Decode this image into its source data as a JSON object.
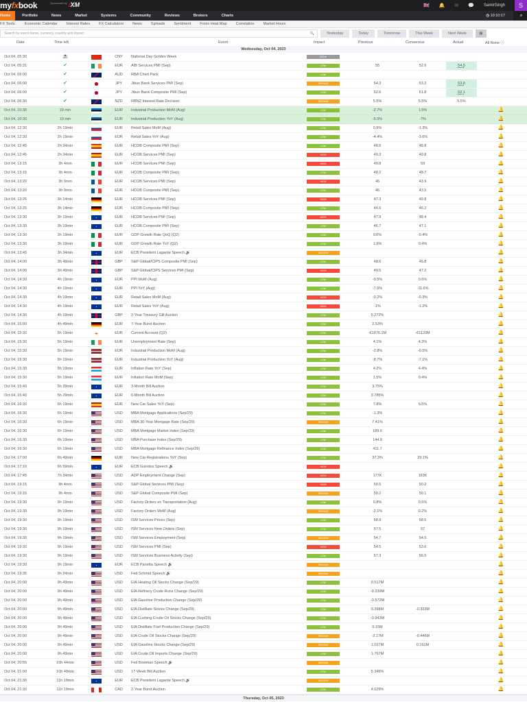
{
  "header": {
    "logo": "myfxbook",
    "sponsored": "Sponsored by",
    "sponsor": "XM",
    "user": "SamirSingh",
    "avatar": "S",
    "clock": "10:10:17"
  },
  "nav": [
    "Home",
    "Portfolio",
    "News",
    "Market",
    "Systems",
    "Community",
    "Reviews",
    "Brokers",
    "Charts"
  ],
  "tools": [
    "FX Tools:",
    "Economic Calendar",
    "Interest Rates",
    "FX Calculators",
    "News",
    "Spreads",
    "Sentiment",
    "Forex Heat Map",
    "Correlation",
    "Market Hours"
  ],
  "search": {
    "placeholder": "Search by event name, currency, country and impact"
  },
  "date_buttons": [
    "Yesterday",
    "Today",
    "Tomorrow",
    "This Week",
    "Next Week"
  ],
  "columns": {
    "date": "Date",
    "left": "Time left",
    "event": "Event",
    "impact": "Impact",
    "previous": "Previous",
    "consensus": "Consensus",
    "actual": "Actual",
    "allnone": "All None"
  },
  "day_header": "Wednesday, Oct 04, 2023",
  "next_day_header": "Thursday, Oct 05, 2023",
  "rows": [
    [
      "Oct 04, 05:30",
      "holiday",
      "cn",
      "CNY",
      "National Day Golden Week",
      "NONE",
      "",
      "",
      ""
    ],
    [
      "Oct 04, 05:31",
      "done",
      "ie",
      "EUR",
      "AIB Services PMI (Sep)",
      "LOW",
      "55",
      "52.9",
      "54.5"
    ],
    [
      "Oct 04, 06:00",
      "done",
      "au",
      "AUD",
      "RBA Chart Pack",
      "LOW",
      "",
      "",
      ""
    ],
    [
      "Oct 04, 06:00",
      "done",
      "jp",
      "JPY",
      "Jibun Bank Services PMI (Sep)",
      "MEDIUM",
      "54.3",
      "53.3",
      "53.8"
    ],
    [
      "Oct 04, 06:00",
      "done",
      "jp",
      "JPY",
      "Jibun Bank Composite PMI (Sep)",
      "LOW",
      "52.6",
      "51.8",
      "52.1"
    ],
    [
      "Oct 04, 06:30",
      "done",
      "nz",
      "NZD",
      "RBNZ Interest Rate Decision",
      "MEDIUM",
      "5.5%",
      "5.5%",
      "5.5%"
    ],
    [
      "Oct 04, 10:30",
      "19 min",
      "ee",
      "EUR",
      "Industrial Production MoM (Aug)",
      "LOW",
      "-2.7%",
      "1.5%",
      ""
    ],
    [
      "Oct 04, 10:30",
      "19 min",
      "ee",
      "EUR",
      "Industrial Production YoY (Aug)",
      "LOW",
      "-5.5%",
      "-7%",
      ""
    ],
    [
      "Oct 04, 12:30",
      "2h 19min",
      "sk",
      "EUR",
      "Retail Sales MoM (Aug)",
      "LOW",
      "0.9%",
      "-1.3%",
      ""
    ],
    [
      "Oct 04, 12:30",
      "2h 19min",
      "sk",
      "EUR",
      "Retail Sales YoY (Aug)",
      "LOW",
      "-4.4%",
      "-3.6%",
      ""
    ],
    [
      "Oct 04, 12:45",
      "2h 34min",
      "es",
      "EUR",
      "HCOB Composite PMI (Sep)",
      "LOW",
      "48.6",
      "48.8",
      ""
    ],
    [
      "Oct 04, 12:45",
      "2h 34min",
      "es",
      "EUR",
      "HCOB Services PMI (Sep)",
      "HIGH",
      "49.3",
      "49.8",
      ""
    ],
    [
      "Oct 04, 13:15",
      "3h 4min",
      "it",
      "EUR",
      "HCOB Services PMI (Sep)",
      "HIGH",
      "49.8",
      "50",
      ""
    ],
    [
      "Oct 04, 13:15",
      "3h 4min",
      "it",
      "EUR",
      "HCOB Composite PMI (Sep)",
      "LOW",
      "48.2",
      "48.7",
      ""
    ],
    [
      "Oct 04, 13:20",
      "3h 9min",
      "fr",
      "EUR",
      "HCOB Services PMI (Sep)",
      "HIGH",
      "46",
      "43.9",
      ""
    ],
    [
      "Oct 04, 13:20",
      "3h 9min",
      "fr",
      "EUR",
      "HCOB Composite PMI (Sep)",
      "LOW",
      "46",
      "43.5",
      ""
    ],
    [
      "Oct 04, 13:25",
      "3h 14min",
      "de",
      "EUR",
      "HCOB Services PMI (Sep)",
      "HIGH",
      "47.3",
      "49.8",
      ""
    ],
    [
      "Oct 04, 13:25",
      "3h 14min",
      "de",
      "EUR",
      "HCOB Composite PMI (Sep)",
      "LOW",
      "44.6",
      "46.2",
      ""
    ],
    [
      "Oct 04, 13:30",
      "3h 19min",
      "eu",
      "EUR",
      "HCOB Services PMI (Sep)",
      "HIGH",
      "47.9",
      "48.4",
      ""
    ],
    [
      "Oct 04, 13:30",
      "3h 19min",
      "eu",
      "EUR",
      "HCOB Composite PMI (Sep)",
      "LOW",
      "46.7",
      "47.1",
      ""
    ],
    [
      "Oct 04, 13:30",
      "3h 19min",
      "it",
      "EUR",
      "GDP Growth Rate QoQ (Q2)",
      "LOW",
      "0.6%",
      "-0.4%",
      ""
    ],
    [
      "Oct 04, 13:30",
      "3h 19min",
      "it",
      "EUR",
      "GDP Growth Rate YoY (Q2)",
      "LOW",
      "1.9%",
      "0.4%",
      ""
    ],
    [
      "Oct 04, 13:45",
      "3h 34min",
      "eu",
      "EUR",
      "ECB President Lagarde Speech 🔊",
      "MEDIUM",
      "",
      "",
      ""
    ],
    [
      "Oct 04, 14:00",
      "3h 49min",
      "gb",
      "GBP",
      "S&P Global/CIPS Composite PMI (Sep)",
      "LOW",
      "48.6",
      "46.8",
      ""
    ],
    [
      "Oct 04, 14:00",
      "3h 49min",
      "gb",
      "GBP",
      "S&P Global/CIPS Services PMI (Sep)",
      "HIGH",
      "49.5",
      "47.2",
      ""
    ],
    [
      "Oct 04, 14:30",
      "4h 19min",
      "eu",
      "EUR",
      "PPI MoM (Aug)",
      "LOW",
      "-0.5%",
      "0.6%",
      ""
    ],
    [
      "Oct 04, 14:30",
      "4h 19min",
      "eu",
      "EUR",
      "PPI YoY (Aug)",
      "LOW",
      "-7.6%",
      "-11.6%",
      ""
    ],
    [
      "Oct 04, 14:30",
      "4h 19min",
      "eu",
      "EUR",
      "Retail Sales MoM (Aug)",
      "HIGH",
      "-0.2%",
      "-0.3%",
      ""
    ],
    [
      "Oct 04, 14:30",
      "4h 19min",
      "eu",
      "EUR",
      "Retail Sales YoY (Aug)",
      "HIGH",
      "-1%",
      "-1.2%",
      ""
    ],
    [
      "Oct 04, 14:30",
      "4h 19min",
      "gb",
      "GBP",
      "2-Year Treasury Gilt Auction",
      "LOW",
      "5.272%",
      "",
      ""
    ],
    [
      "Oct 04, 15:00",
      "4h 49min",
      "de",
      "EUR",
      "7-Year Bund Auction",
      "LOW",
      "2.53%",
      "",
      ""
    ],
    [
      "Oct 04, 15:30",
      "5h 19min",
      "cy",
      "EUR",
      "Current Account (Q2)",
      "LOW",
      "-€1876.1M",
      "-€1120M",
      ""
    ],
    [
      "Oct 04, 15:30",
      "5h 19min",
      "ie",
      "EUR",
      "Unemployment Rate (Sep)",
      "LOW",
      "4.1%",
      "4.3%",
      ""
    ],
    [
      "Oct 04, 15:30",
      "5h 19min",
      "lv",
      "EUR",
      "Industrial Production MoM (Aug)",
      "LOW",
      "-2.8%",
      "-0.5%",
      ""
    ],
    [
      "Oct 04, 15:30",
      "5h 19min",
      "lv",
      "EUR",
      "Industrial Production YoY (Aug)",
      "LOW",
      "-8.7%",
      "-7.1%",
      ""
    ],
    [
      "Oct 04, 15:30",
      "5h 19min",
      "lu",
      "EUR",
      "Inflation Rate YoY (Sep)",
      "LOW",
      "4.2%",
      "4.4%",
      ""
    ],
    [
      "Oct 04, 15:30",
      "5h 19min",
      "lu",
      "EUR",
      "Inflation Rate MoM (Sep)",
      "LOW",
      "1.5%",
      "0.4%",
      ""
    ],
    [
      "Oct 04, 15:40",
      "5h 29min",
      "eu",
      "EUR",
      "3-Month Bill Auction",
      "LOW",
      "3.75%",
      "",
      ""
    ],
    [
      "Oct 04, 15:40",
      "5h 29min",
      "eu",
      "EUR",
      "6-Month Bill Auction",
      "LOW",
      "3.785%",
      "",
      ""
    ],
    [
      "Oct 04, 16:30",
      "6h 19min",
      "es",
      "EUR",
      "New Car Sales YoY (Sep)",
      "LOW",
      "7.8%",
      "6.5%",
      ""
    ],
    [
      "Oct 04, 16:30",
      "6h 19min",
      "us",
      "USD",
      "MBA Mortgage Applications (Sep/29)",
      "LOW",
      "-1.3%",
      "",
      ""
    ],
    [
      "Oct 04, 16:30",
      "6h 19min",
      "us",
      "USD",
      "MBA 30-Year Mortgage Rate (Sep/29)",
      "MEDIUM",
      "7.41%",
      "",
      ""
    ],
    [
      "Oct 04, 16:30",
      "6h 19min",
      "us",
      "USD",
      "MBA Mortgage Market Index (Sep/29)",
      "LOW",
      "189.6",
      "",
      ""
    ],
    [
      "Oct 04, 16:30",
      "6h 19min",
      "us",
      "USD",
      "MBA Purchase Index (Sep/29)",
      "LOW",
      "144.8",
      "",
      ""
    ],
    [
      "Oct 04, 16:30",
      "6h 19min",
      "us",
      "USD",
      "MBA Mortgage Refinance Index (Sep/29)",
      "LOW",
      "411.7",
      "",
      ""
    ],
    [
      "Oct 04, 17:00",
      "6h 49min",
      "de",
      "EUR",
      "New Car Registrations YoY (Sep)",
      "LOW",
      "37.3%",
      "29.1%",
      ""
    ],
    [
      "Oct 04, 17:10",
      "6h 59min",
      "eu",
      "EUR",
      "ECB Guindos Speech 🔊",
      "HIGH",
      "",
      "",
      ""
    ],
    [
      "Oct 04, 17:45",
      "7h 34min",
      "us",
      "USD",
      "ADP Employment Change (Sep)",
      "HIGH",
      "177K",
      "153K",
      ""
    ],
    [
      "Oct 04, 19:15",
      "9h 4min",
      "us",
      "USD",
      "S&P Global Services PMI (Sep)",
      "HIGH",
      "50.5",
      "50.2",
      ""
    ],
    [
      "Oct 04, 19:15",
      "9h 4min",
      "us",
      "USD",
      "S&P Global Composite PMI (Sep)",
      "MEDIUM",
      "50.2",
      "50.1",
      ""
    ],
    [
      "Oct 04, 19:30",
      "9h 19min",
      "us",
      "USD",
      "Factory Orders ex Transportation (Aug)",
      "LOW",
      "0.8%",
      "0.6%",
      ""
    ],
    [
      "Oct 04, 19:30",
      "9h 19min",
      "us",
      "USD",
      "Factory Orders MoM (Aug)",
      "MEDIUM",
      "-2.1%",
      "0.2%",
      ""
    ],
    [
      "Oct 04, 19:30",
      "9h 19min",
      "us",
      "USD",
      "ISM Services Prices (Sep)",
      "LOW",
      "58.9",
      "58.5",
      ""
    ],
    [
      "Oct 04, 19:30",
      "9h 19min",
      "us",
      "USD",
      "ISM Services New Orders (Sep)",
      "LOW",
      "57.5",
      "57",
      ""
    ],
    [
      "Oct 04, 19:30",
      "9h 19min",
      "us",
      "USD",
      "ISM Services Employment (Sep)",
      "MEDIUM",
      "54.7",
      "54.5",
      ""
    ],
    [
      "Oct 04, 19:30",
      "9h 19min",
      "us",
      "USD",
      "ISM Services PMI (Sep)",
      "HIGH",
      "54.5",
      "53.6",
      ""
    ],
    [
      "Oct 04, 19:30",
      "9h 19min",
      "us",
      "USD",
      "ISM Services Business Activity (Sep)",
      "LOW",
      "57.3",
      "56.5",
      ""
    ],
    [
      "Oct 04, 19:30",
      "9h 19min",
      "eu",
      "EUR",
      "ECB Panetta Speech 🔊",
      "MEDIUM",
      "",
      "",
      ""
    ],
    [
      "Oct 04, 19:35",
      "9h 24min",
      "us",
      "USD",
      "Fed Schmid Speech 🔊",
      "MEDIUM",
      "",
      "",
      ""
    ],
    [
      "Oct 04, 20:00",
      "9h 49min",
      "us",
      "USD",
      "EIA Heating Oil Stocks Change (Sep/29)",
      "LOW",
      "0.517M",
      "",
      ""
    ],
    [
      "Oct 04, 20:00",
      "9h 49min",
      "us",
      "USD",
      "EIA Refinery Crude Runs Change (Sep/29)",
      "LOW",
      "-0.239M",
      "",
      ""
    ],
    [
      "Oct 04, 20:00",
      "9h 49min",
      "us",
      "USD",
      "EIA Gasoline Production Change (Sep/29)",
      "LOW",
      "-0.572M",
      "",
      ""
    ],
    [
      "Oct 04, 20:00",
      "9h 49min",
      "us",
      "USD",
      "EIA Distillate Stocks Change (Sep/29)",
      "LOW",
      "0.398M",
      "-0.333M",
      ""
    ],
    [
      "Oct 04, 20:00",
      "9h 49min",
      "us",
      "USD",
      "EIA Cushing Crude Oil Stocks Change (Sep/29)",
      "LOW",
      "-0.943M",
      "",
      ""
    ],
    [
      "Oct 04, 20:00",
      "9h 49min",
      "us",
      "USD",
      "EIA Distillate Fuel Production Change (Sep/29)",
      "LOW",
      "0.15M",
      "",
      ""
    ],
    [
      "Oct 04, 20:00",
      "9h 49min",
      "us",
      "USD",
      "EIA Crude Oil Stocks Change (Sep/29)",
      "MEDIUM",
      "-2.17M",
      "-0.446M",
      ""
    ],
    [
      "Oct 04, 20:00",
      "9h 49min",
      "us",
      "USD",
      "EIA Gasoline Stocks Change (Sep/29)",
      "MEDIUM",
      "1.027M",
      "0.161M",
      ""
    ],
    [
      "Oct 04, 20:00",
      "9h 49min",
      "us",
      "USD",
      "EIA Crude Oil Imports Change (Sep/29)",
      "LOW",
      "1.767M",
      "",
      ""
    ],
    [
      "Oct 04, 20:55",
      "10h 44min",
      "us",
      "USD",
      "Fed Bowman Speech 🔊",
      "MEDIUM",
      "",
      "",
      ""
    ],
    [
      "Oct 04, 21:00",
      "10h 49min",
      "us",
      "USD",
      "17-Week Bill Auction",
      "LOW",
      "5.345%",
      "",
      ""
    ],
    [
      "Oct 04, 21:30",
      "11h 19min",
      "eu",
      "EUR",
      "ECB President Lagarde Speech 🔊",
      "MEDIUM",
      "",
      "",
      ""
    ],
    [
      "Oct 04, 21:30",
      "11h 19min",
      "ca",
      "CAD",
      "2-Year Bond Auction",
      "LOW",
      "4.629%",
      "",
      ""
    ]
  ],
  "highlight_rows": [
    6,
    7
  ],
  "green_actual_rows": [
    1,
    3,
    4
  ],
  "colors": {
    "LOW": "#8cbf3a",
    "MEDIUM": "#f7a21b",
    "HIGH": "#f4493a",
    "NONE": "#999999",
    "accent": "#f47b20"
  }
}
